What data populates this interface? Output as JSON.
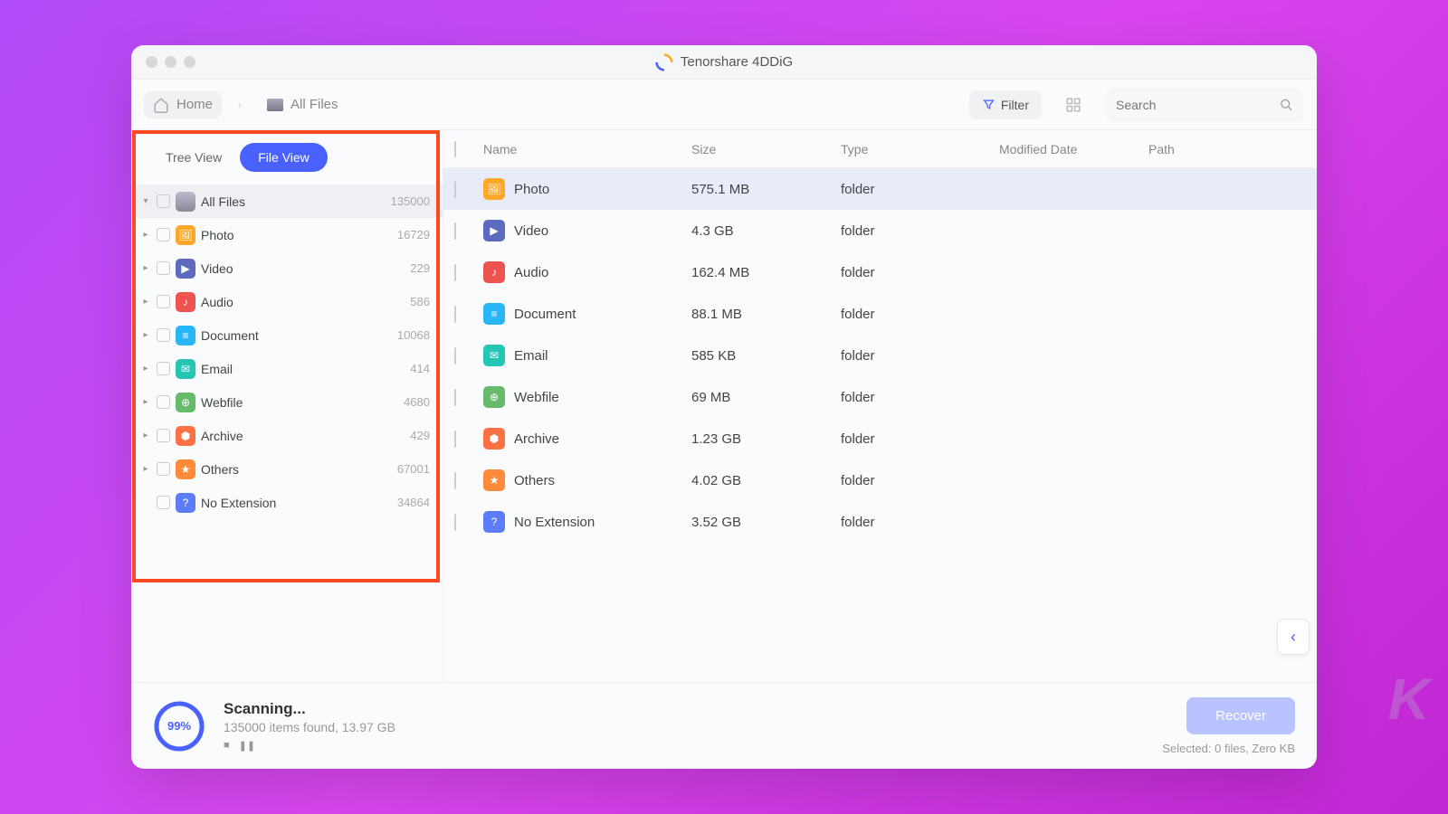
{
  "app": {
    "title": "Tenorshare 4DDiG"
  },
  "toolbar": {
    "home": "Home",
    "all_files": "All Files",
    "filter": "Filter",
    "search_placeholder": "Search"
  },
  "viewToggle": {
    "tree": "Tree View",
    "file": "File View"
  },
  "sidebar": {
    "root": {
      "label": "All Files",
      "count": "135000"
    },
    "items": [
      {
        "label": "Photo",
        "count": "16729",
        "cls": "photo",
        "glyph": "🖼"
      },
      {
        "label": "Video",
        "count": "229",
        "cls": "video",
        "glyph": "▶"
      },
      {
        "label": "Audio",
        "count": "586",
        "cls": "audio",
        "glyph": "♪"
      },
      {
        "label": "Document",
        "count": "10068",
        "cls": "doc",
        "glyph": "≡"
      },
      {
        "label": "Email",
        "count": "414",
        "cls": "email",
        "glyph": "✉"
      },
      {
        "label": "Webfile",
        "count": "4680",
        "cls": "web",
        "glyph": "⊕"
      },
      {
        "label": "Archive",
        "count": "429",
        "cls": "arch",
        "glyph": "⬢"
      },
      {
        "label": "Others",
        "count": "67001",
        "cls": "other",
        "glyph": "★"
      },
      {
        "label": "No Extension",
        "count": "34864",
        "cls": "noext",
        "glyph": "?"
      }
    ]
  },
  "table": {
    "headers": {
      "name": "Name",
      "size": "Size",
      "type": "Type",
      "mod": "Modified Date",
      "path": "Path"
    },
    "rows": [
      {
        "name": "Photo",
        "size": "575.1 MB",
        "type": "folder",
        "cls": "photo",
        "glyph": "🖼",
        "sel": true
      },
      {
        "name": "Video",
        "size": "4.3 GB",
        "type": "folder",
        "cls": "video",
        "glyph": "▶"
      },
      {
        "name": "Audio",
        "size": "162.4 MB",
        "type": "folder",
        "cls": "audio",
        "glyph": "♪"
      },
      {
        "name": "Document",
        "size": "88.1 MB",
        "type": "folder",
        "cls": "doc",
        "glyph": "≡"
      },
      {
        "name": "Email",
        "size": "585 KB",
        "type": "folder",
        "cls": "email",
        "glyph": "✉"
      },
      {
        "name": "Webfile",
        "size": "69 MB",
        "type": "folder",
        "cls": "web",
        "glyph": "⊕"
      },
      {
        "name": "Archive",
        "size": "1.23 GB",
        "type": "folder",
        "cls": "arch",
        "glyph": "⬢"
      },
      {
        "name": "Others",
        "size": "4.02 GB",
        "type": "folder",
        "cls": "other",
        "glyph": "★"
      },
      {
        "name": "No Extension",
        "size": "3.52 GB",
        "type": "folder",
        "cls": "noext",
        "glyph": "?"
      }
    ]
  },
  "status": {
    "pct": "99%",
    "title": "Scanning...",
    "sub": "135000 items found, 13.97 GB",
    "recover": "Recover",
    "selected": "Selected: 0 files, Zero KB"
  },
  "watermark": "K"
}
